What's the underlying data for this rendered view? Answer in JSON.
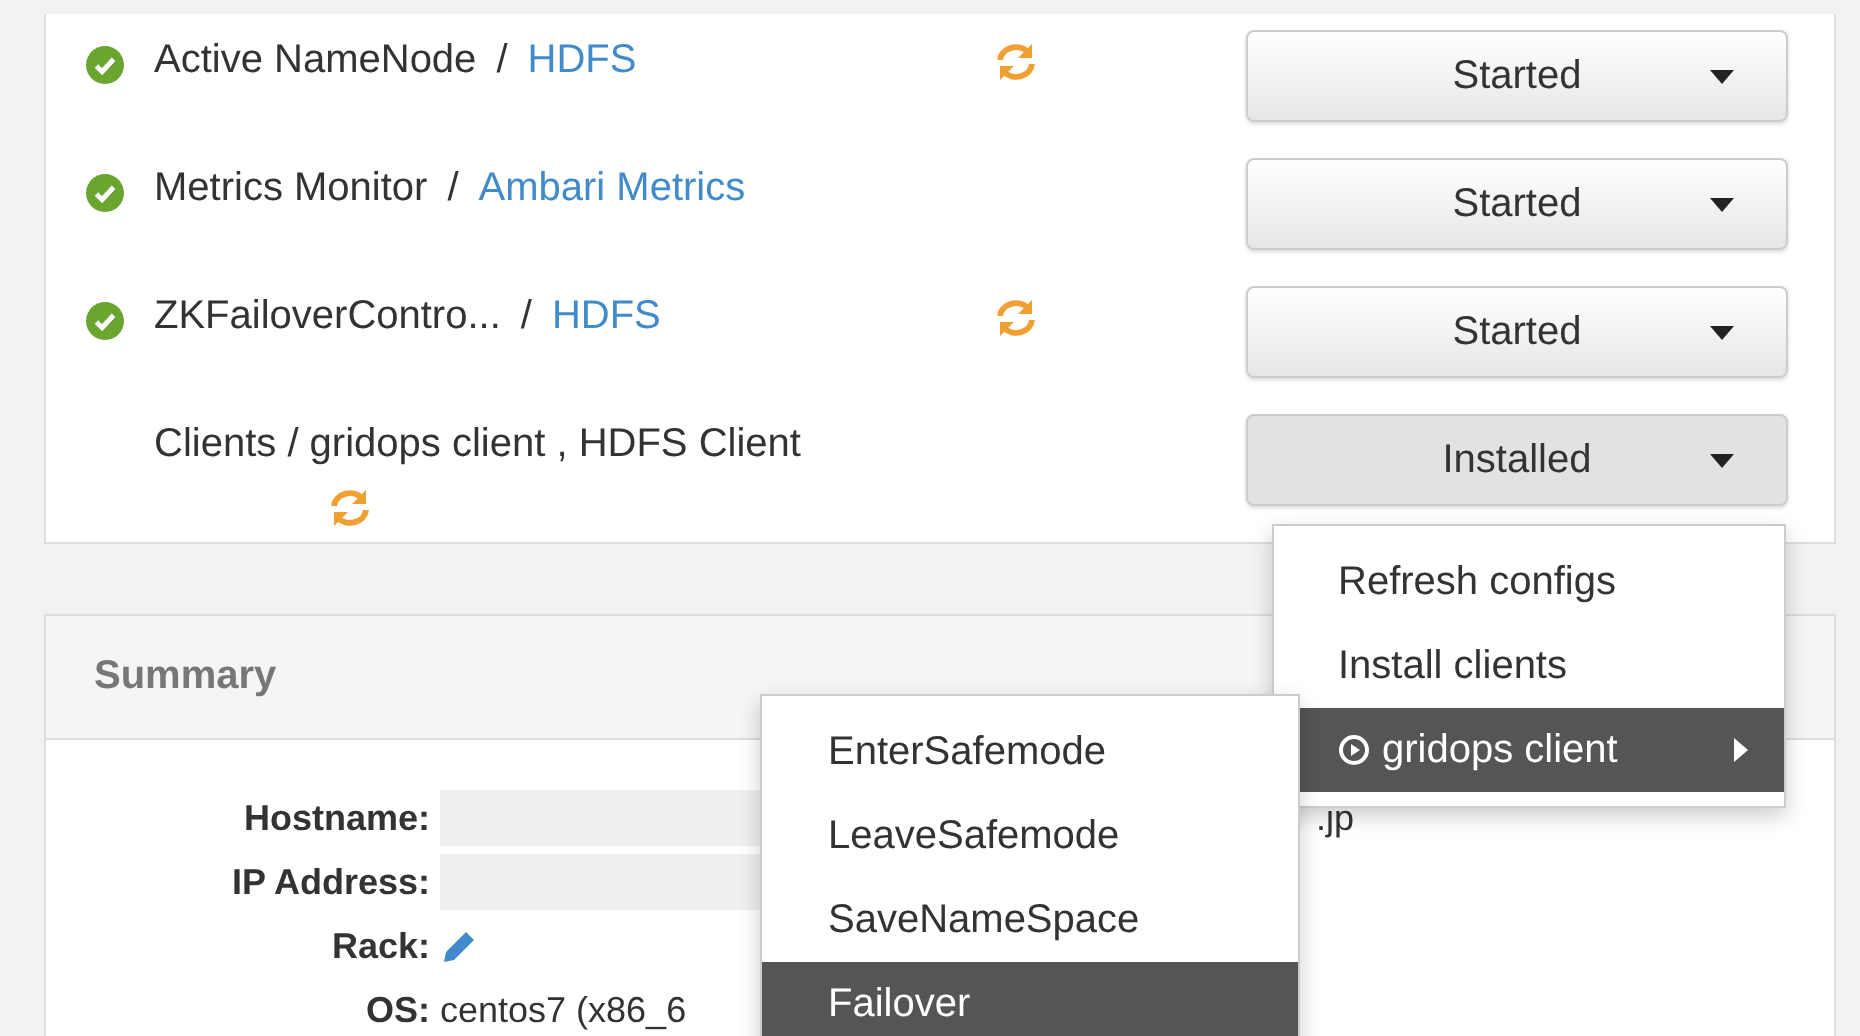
{
  "components": [
    {
      "name": "Active NameNode",
      "separator": "/",
      "service": "HDFS",
      "ok": true,
      "restart_needed": true,
      "action": "Started"
    },
    {
      "name": "Metrics Monitor",
      "separator": "/",
      "service": "Ambari Metrics",
      "ok": true,
      "restart_needed": false,
      "action": "Started"
    },
    {
      "name": "ZKFailoverContro...",
      "separator": "/",
      "service": "HDFS",
      "ok": true,
      "restart_needed": true,
      "action": "Started"
    },
    {
      "name": "Clients / gridops client , HDFS Client",
      "ok": false,
      "restart_needed": true,
      "action": "Installed"
    }
  ],
  "summary": {
    "title": "Summary",
    "fields": [
      {
        "label": "Hostname:",
        "value": ".jp",
        "kind": "redacted"
      },
      {
        "label": "IP Address:",
        "kind": "redacted"
      },
      {
        "label": "Rack:",
        "kind": "edit"
      },
      {
        "label": "OS:",
        "value": "centos7 (x86_6",
        "kind": "text"
      }
    ]
  },
  "action_menu": {
    "items": [
      {
        "label": "Refresh configs",
        "selected": false,
        "submenu": false
      },
      {
        "label": "Install clients",
        "selected": false,
        "submenu": false
      },
      {
        "label": "gridops client",
        "selected": true,
        "submenu": true
      }
    ]
  },
  "submenu": {
    "items": [
      {
        "label": "EnterSafemode",
        "selected": false
      },
      {
        "label": "LeaveSafemode",
        "selected": false
      },
      {
        "label": "SaveNameSpace",
        "selected": false
      },
      {
        "label": "Failover",
        "selected": true
      }
    ]
  }
}
